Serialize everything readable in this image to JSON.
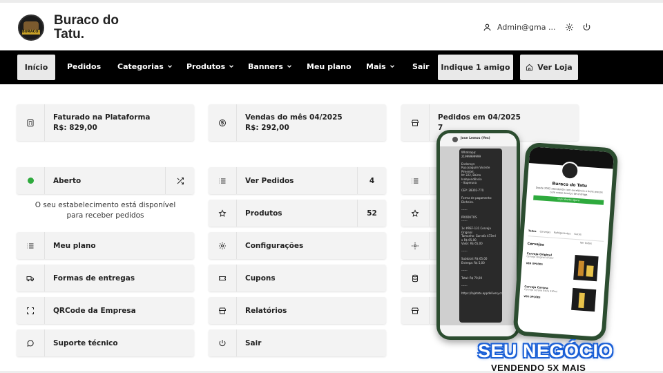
{
  "header": {
    "brand": "Buraco do Tatu.",
    "logo_text": "BURACO DO TATU",
    "user_email": "Admin@gma ..."
  },
  "nav": {
    "items": [
      {
        "label": "Início"
      },
      {
        "label": "Pedidos"
      },
      {
        "label": "Categorias"
      },
      {
        "label": "Produtos"
      },
      {
        "label": "Banners"
      },
      {
        "label": "Meu plano"
      },
      {
        "label": "Mais"
      },
      {
        "label": "Sair"
      }
    ],
    "indique": "Indique 1 amigo",
    "ver_loja": "Ver Loja"
  },
  "stats": [
    {
      "label": "Faturado na Plataforma",
      "value": "R$: 829,00"
    },
    {
      "label": "Vendas do mês 04/2025",
      "value": "R$: 292,00"
    },
    {
      "label": "Pedidos em 04/2025",
      "value": "7"
    }
  ],
  "col1": {
    "status_label": "Aberto",
    "status_text_1": "O seu estabelecimento está disponível",
    "status_text_2": "para receber pedidos",
    "meu_plano": "Meu plano",
    "formas": "Formas de entregas",
    "qrcode": "QRCode da Empresa",
    "suporte": "Suporte técnico"
  },
  "col2": {
    "ver_pedidos": "Ver Pedidos",
    "ver_pedidos_count": "4",
    "produtos": "Produtos",
    "produtos_count": "52",
    "configuracoes": "Configurações",
    "cupons": "Cupons",
    "relatorios": "Relatórios",
    "sair": "Sair"
  },
  "phone_left": {
    "contact": "Jose Lemos (Yes)",
    "chat": "Whatsapp:\n21999999999\n\nEndereço:\nRua Joaquim Vicente Pimentel,\nNº 322, Bairro Independência\n- Itaperuna\n\nCEP: 28302-770.\n\nForma de pagamento:\nDinheiro.\n\n------\n\nPRODUTOS\n------\n\n1x #REF-131 Cerveja Original\nTamanho: Garrafa 473ml\nx R$ 65,00\nValor: R$ 65,00\n\n------\n\nSubtotal: R$ 65,00\nEntrega: R$ 5,00\n\n------\n\nTotal: R$ 70,00\n\n------\n\nhttps://lojatatu.appdelivery.com.br"
  },
  "phone_right": {
    "store_name": "Buraco do Tatu",
    "store_desc": "Desde 2002 atendendo com excelência e bons preços com nosso serviço de entrega.",
    "open_label": "Loja aberta agora",
    "tabs": [
      "Todos",
      "Cervejas",
      "Refrigerantes",
      "Sucos",
      "Destilados"
    ],
    "section": "Cervejas",
    "see_all": "Ver todos",
    "products": [
      {
        "name": "Cerveja Original",
        "desc": "Cerveja Original 473ml"
      },
      {
        "name": "Cerveja Corona",
        "desc": "Cerveja Corona Extra 330ml"
      }
    ],
    "options_label": "VER OPÇÕES"
  },
  "promo": {
    "line1": "SEU NEGÓCIO",
    "line2": "VENDENDO 5X MAIS"
  },
  "colors": {
    "nav_bg": "#000000",
    "card_bg": "#f3f3f3",
    "status_green": "#2eaa3d",
    "promo_blue": "#1a5fd6"
  }
}
